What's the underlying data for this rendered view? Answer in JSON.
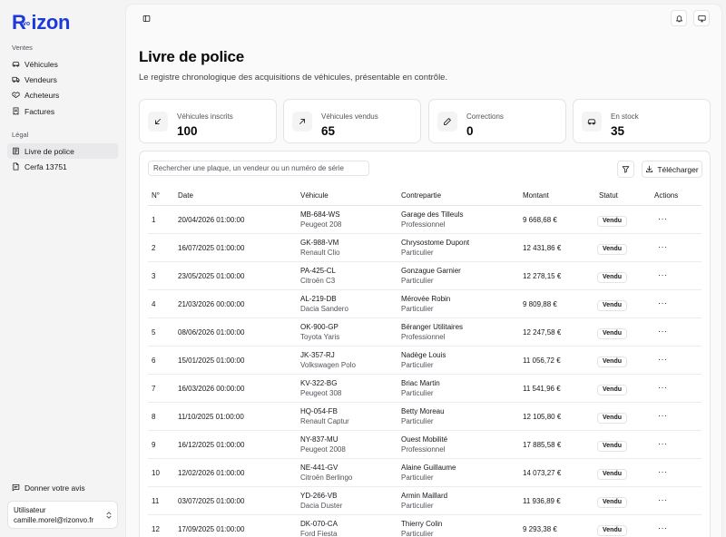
{
  "brand": {
    "logo_r": "R",
    "logo_vo": "vo",
    "logo_rest": "izon"
  },
  "sidebar": {
    "sections": [
      {
        "label": "Ventes",
        "items": [
          {
            "label": "Véhicules",
            "icon": "car-icon"
          },
          {
            "label": "Vendeurs",
            "icon": "truck-icon"
          },
          {
            "label": "Acheteurs",
            "icon": "handshake-icon"
          },
          {
            "label": "Factures",
            "icon": "receipt-icon"
          }
        ]
      },
      {
        "label": "Légal",
        "items": [
          {
            "label": "Livre de police",
            "icon": "book-icon",
            "active": true
          },
          {
            "label": "Cerfa 13751",
            "icon": "file-icon"
          }
        ]
      }
    ],
    "feedback": "Donner votre avis",
    "user": {
      "title": "Utilisateur",
      "email": "camille.morel@rizonvo.fr"
    }
  },
  "page": {
    "title": "Livre de police",
    "subtitle": "Le registre chronologique des acquisitions de véhicules, présentable en contrôle."
  },
  "stats": [
    {
      "label": "Véhicules inscrits",
      "value": "100",
      "icon": "arrow-down-left-icon"
    },
    {
      "label": "Véhicules vendus",
      "value": "65",
      "icon": "arrow-up-right-icon"
    },
    {
      "label": "Corrections",
      "value": "0",
      "icon": "pencil-icon"
    },
    {
      "label": "En stock",
      "value": "35",
      "icon": "car-icon"
    }
  ],
  "toolbar": {
    "search_placeholder": "Rechercher une plaque, un vendeur ou un numéro de série",
    "download_label": "Télécharger"
  },
  "table": {
    "headers": [
      "N°",
      "Date",
      "Véhicule",
      "Contrepartie",
      "Montant",
      "Statut",
      "Actions"
    ],
    "rows": [
      {
        "num": "1",
        "date": "20/04/2026 01:00:00",
        "plate": "MB-684-WS",
        "model": "Peugeot 208",
        "party": "Garage des Tilleuls",
        "party_type": "Professionnel",
        "amount": "9 668,68 €",
        "status": "Vendu"
      },
      {
        "num": "2",
        "date": "16/07/2025 01:00:00",
        "plate": "GK-988-VM",
        "model": "Renault Clio",
        "party": "Chrysostome Dupont",
        "party_type": "Particulier",
        "amount": "12 431,86 €",
        "status": "Vendu"
      },
      {
        "num": "3",
        "date": "23/05/2025 01:00:00",
        "plate": "PA-425-CL",
        "model": "Citroën C3",
        "party": "Gonzague Garnier",
        "party_type": "Particulier",
        "amount": "12 278,15 €",
        "status": "Vendu"
      },
      {
        "num": "4",
        "date": "21/03/2026 00:00:00",
        "plate": "AL-219-DB",
        "model": "Dacia Sandero",
        "party": "Mérovée Robin",
        "party_type": "Particulier",
        "amount": "9 809,88 €",
        "status": "Vendu"
      },
      {
        "num": "5",
        "date": "08/06/2026 01:00:00",
        "plate": "OK-900-GP",
        "model": "Toyota Yaris",
        "party": "Béranger Utilitaires",
        "party_type": "Professionnel",
        "amount": "12 247,58 €",
        "status": "Vendu"
      },
      {
        "num": "6",
        "date": "15/01/2025 01:00:00",
        "plate": "JK-357-RJ",
        "model": "Volkswagen Polo",
        "party": "Nadège Louis",
        "party_type": "Particulier",
        "amount": "11 056,72 €",
        "status": "Vendu"
      },
      {
        "num": "7",
        "date": "16/03/2026 00:00:00",
        "plate": "KV-322-BG",
        "model": "Peugeot 308",
        "party": "Briac Martin",
        "party_type": "Particulier",
        "amount": "11 541,96 €",
        "status": "Vendu"
      },
      {
        "num": "8",
        "date": "11/10/2025 01:00:00",
        "plate": "HQ-054-FB",
        "model": "Renault Captur",
        "party": "Betty Moreau",
        "party_type": "Particulier",
        "amount": "12 105,80 €",
        "status": "Vendu"
      },
      {
        "num": "9",
        "date": "16/12/2025 01:00:00",
        "plate": "NY-837-MU",
        "model": "Peugeot 2008",
        "party": "Ouest Mobilité",
        "party_type": "Professionnel",
        "amount": "17 885,58 €",
        "status": "Vendu"
      },
      {
        "num": "10",
        "date": "12/02/2026 01:00:00",
        "plate": "NE-441-GV",
        "model": "Citroën Berlingo",
        "party": "Alaine Guillaume",
        "party_type": "Particulier",
        "amount": "14 073,27 €",
        "status": "Vendu"
      },
      {
        "num": "11",
        "date": "03/07/2025 01:00:00",
        "plate": "YD-266-VB",
        "model": "Dacia Duster",
        "party": "Armin Maillard",
        "party_type": "Particulier",
        "amount": "11 936,89 €",
        "status": "Vendu"
      },
      {
        "num": "12",
        "date": "17/09/2025 01:00:00",
        "plate": "DK-070-CA",
        "model": "Ford Fiesta",
        "party": "Thierry Colin",
        "party_type": "Particulier",
        "amount": "9 293,38 €",
        "status": "Vendu"
      }
    ]
  },
  "colors": {
    "brand": "#1d3ad8",
    "background": "#f4f4f5",
    "card": "#ffffff",
    "border": "#e4e4e7"
  }
}
